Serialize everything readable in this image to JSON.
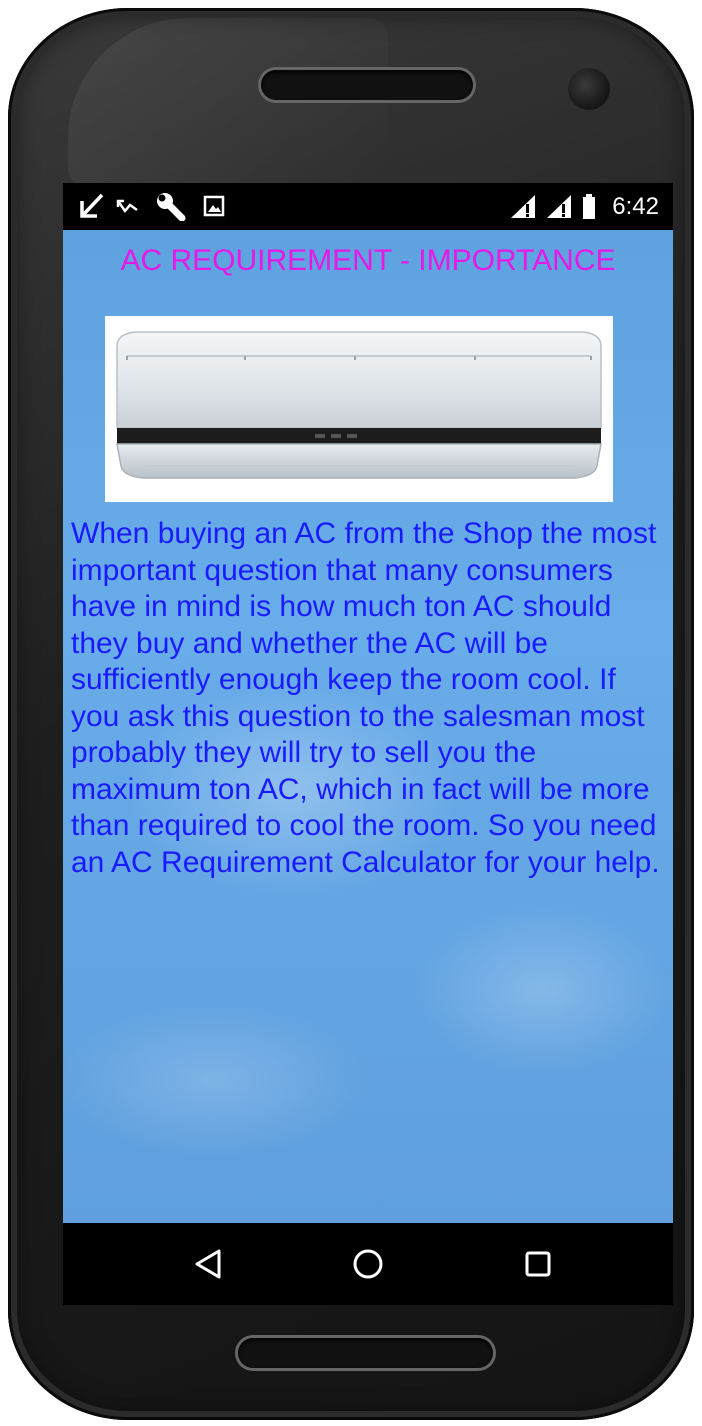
{
  "status_bar": {
    "time": "6:42",
    "left_icons": [
      "download-arrow-icon",
      "missed-call-icon",
      "wrench-icon",
      "image-icon"
    ],
    "right_icons": [
      "signal-icon",
      "signal-icon",
      "battery-icon"
    ]
  },
  "main": {
    "title": "AC REQUIREMENT - IMPORTANCE",
    "image_alt": "air-conditioner-image",
    "description": "When buying an AC from the Shop the most important question that many consumers have in mind is how much ton AC should they buy and whether the AC will be sufficiently enough keep the room cool. If you ask this question to the salesman most probably they will try to sell you the maximum ton AC, which in fact will be more than required to cool the room. So you need an AC Requirement Calculator for your help."
  },
  "nav_bar": {
    "buttons": [
      "back-icon",
      "home-icon",
      "recents-icon"
    ]
  },
  "colors": {
    "title": "#e619e6",
    "body_text": "#1a1aff",
    "background": "#64a6e5"
  }
}
